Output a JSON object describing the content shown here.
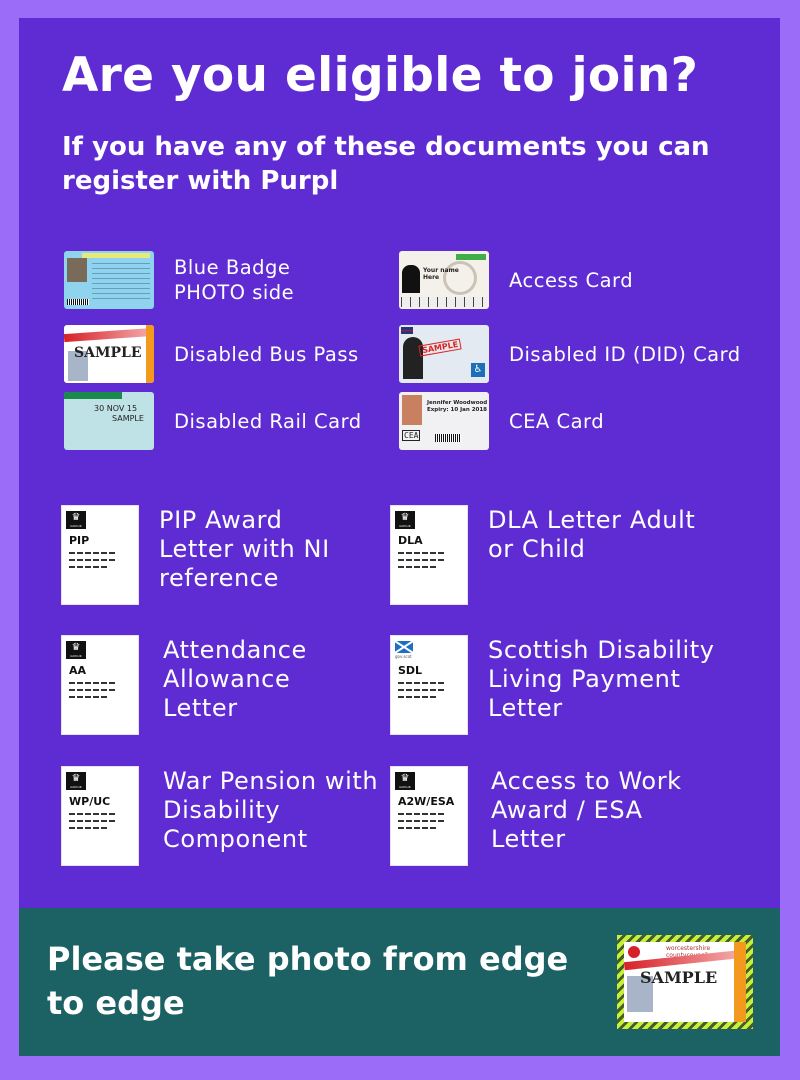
{
  "header": {
    "title": "Are you eligible to join?",
    "subtitle": "If you have any of these documents you can register with Purpl"
  },
  "cards": [
    {
      "label": "Blue Badge PHOTO side",
      "icon": "blue-badge-card-icon"
    },
    {
      "label": "Access Card",
      "icon": "access-card-icon"
    },
    {
      "label": "Disabled Bus Pass",
      "icon": "bus-pass-card-icon",
      "stamp": "SAMPLE"
    },
    {
      "label": "Disabled ID (DID) Card",
      "icon": "did-card-icon",
      "stamp": "SAMPLE"
    },
    {
      "label": "Disabled Rail Card",
      "icon": "rail-card-icon",
      "date": "30 NOV 15",
      "stamp": "SAMPLE"
    },
    {
      "label": "CEA Card",
      "icon": "cea-card-icon",
      "name": "Jennifer Woodwood",
      "expiry": "Expiry: 10 Jan 2018",
      "logo": "CEA"
    }
  ],
  "letters": [
    {
      "code": "PIP",
      "label": "PIP Award Letter with NI reference",
      "issuer": "gov-uk"
    },
    {
      "code": "DLA",
      "label": "DLA Letter Adult or Child",
      "issuer": "gov-uk"
    },
    {
      "code": "AA",
      "label": "Attendance Allowance Letter",
      "issuer": "gov-uk"
    },
    {
      "code": "SDL",
      "label": "Scottish Disability Living Payment Letter",
      "issuer": "gov-scot"
    },
    {
      "code": "WP/UC",
      "label": "War Pension with Disability Component",
      "issuer": "gov-uk"
    },
    {
      "code": "A2W/ESA",
      "label": "Access to Work Award / ESA Letter",
      "issuer": "gov-uk"
    }
  ],
  "footer": {
    "text": "Please take photo from edge to edge",
    "sample_stamp": "SAMPLE",
    "sample_issuer": "worcestershire countycouncil"
  },
  "colors": {
    "outer_bg": "#9b6cf7",
    "panel_bg": "#5f2cd3",
    "footer_bg": "#1c6163",
    "frame_stripe": "#c4f23a"
  }
}
